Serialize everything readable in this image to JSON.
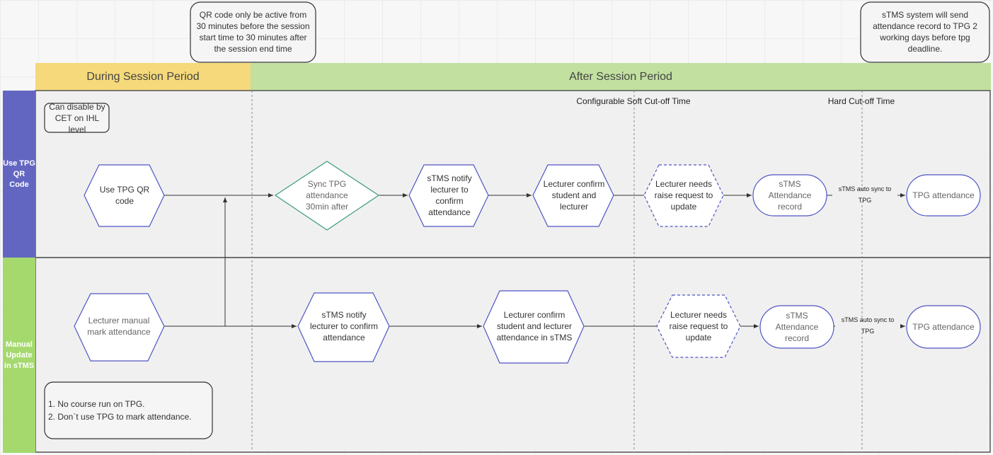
{
  "notes": {
    "qr_active": "QR code only be active from 30 minutes before the session start time to 30 minutes after the session end time",
    "stms_send": "sTMS system will send attendance record to TPG 2 working days before tpg deadline.",
    "can_disable": "Can disable by CET on IHL level",
    "no_course": [
      "1. No course run on TPG.",
      "2. Don`t use TPG to mark attendance."
    ]
  },
  "periods": {
    "during": "During Session Period",
    "after": "After Session Period"
  },
  "cutoffs": {
    "soft": "Configurable Soft Cut-off Time",
    "hard": "Hard Cut-off Time"
  },
  "lanes": {
    "qr": "Use TPG QR Code",
    "manual": "Manual Update in sTMS"
  },
  "lane_qr_nodes": {
    "use_qr": "Use TPG QR code",
    "sync": "Sync TPG attendance 30min after",
    "notify": "sTMS notify lecturer to confirm attendance",
    "confirm": "Lecturer confirm student and lecturer",
    "raise": "Lecturer needs raise request to update",
    "record": "sTMS Attendance record",
    "tpg": "TPG attendance"
  },
  "lane_manual_nodes": {
    "manual_mark": "Lecturer manual mark attendance",
    "notify": "sTMS notify lecturer to confirm attendance",
    "confirm": "Lecturer confirm student and lecturer attendance in sTMS",
    "raise": "Lecturer needs raise request to update",
    "record": "sTMS Attendance record",
    "tpg": "TPG attendance"
  },
  "edge_labels": {
    "auto_sync": "sTMS auto sync to TPG"
  },
  "colors": {
    "during": "#f5d97a",
    "after": "#c2e0a0",
    "lane_qr": "#6366c1",
    "lane_manual": "#a5d96e",
    "node_border": "#4f55c4",
    "diamond_border": "#3a9b7a"
  }
}
